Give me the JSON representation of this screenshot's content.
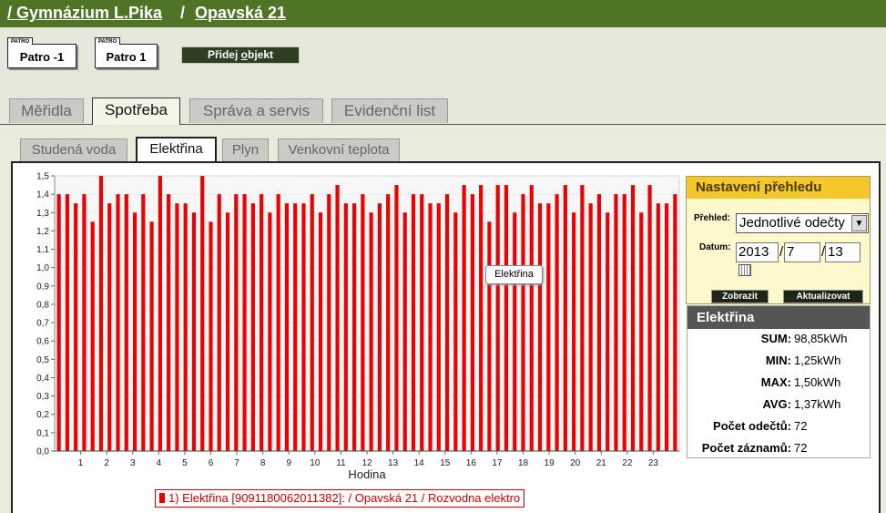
{
  "breadcrumb": {
    "school": "/ Gymnázium L.Pika",
    "sep": "/",
    "address": "Opavská 21"
  },
  "floors": [
    {
      "tag": "PATRO",
      "label": "Patro -1"
    },
    {
      "tag": "PATRO",
      "label": "Patro 1"
    }
  ],
  "add_object": {
    "pre": "Přidej ",
    "accel": "o",
    "post": "bjekt"
  },
  "tabs": [
    "Měřidla",
    "Spotřeba",
    "Správa a servis",
    "Evidenční list"
  ],
  "active_tab": "Spotřeba",
  "subtabs": [
    "Studená voda",
    "Elektřina",
    "Plyn",
    "Venkovní teplota"
  ],
  "active_subtab": "Elektřina",
  "settings": {
    "title": "Nastavení přehledu",
    "prehled_label": "Přehled:",
    "prehled_value": "Jednotlivé odečty",
    "datum_label": "Datum:",
    "year": "2013",
    "month": "7",
    "day": "13",
    "show_button": "Zobrazit",
    "update_button": "Aktualizovat"
  },
  "stats": {
    "title": "Elektřina",
    "rows": [
      {
        "key": "SUM:",
        "value": "98,85kWh"
      },
      {
        "key": "MIN:",
        "value": "1,25kWh"
      },
      {
        "key": "MAX:",
        "value": "1,50kWh"
      },
      {
        "key": "AVG:",
        "value": "1,37kWh"
      },
      {
        "key": "Počet odečtů:",
        "value": "72"
      },
      {
        "key": "Počet záznamů:",
        "value": "72"
      }
    ]
  },
  "tooltip": "Elektřina",
  "legend": "1) Elektřina [9091180062011382]:  / Opavská 21 / Rozvodna elektro",
  "chart_data": {
    "type": "bar",
    "xlabel": "Hodina",
    "ylabel": "",
    "ylim": [
      0,
      1.5
    ],
    "yticks": [
      "0,0",
      "0,1",
      "0,2",
      "0,3",
      "0,4",
      "0,5",
      "0,6",
      "0,7",
      "0,8",
      "0,9",
      "1,0",
      "1,1",
      "1,2",
      "1,3",
      "1,4",
      "1,5"
    ],
    "xticks": [
      "1",
      "2",
      "3",
      "4",
      "5",
      "6",
      "7",
      "8",
      "9",
      "10",
      "11",
      "12",
      "13",
      "14",
      "15",
      "16",
      "17",
      "18",
      "19",
      "20",
      "21",
      "22",
      "23"
    ],
    "grid": true,
    "bar_color": "#ee0000",
    "series": [
      {
        "name": "Elektřina",
        "values": [
          1.4,
          1.4,
          1.35,
          1.4,
          1.25,
          1.5,
          1.35,
          1.4,
          1.4,
          1.3,
          1.4,
          1.25,
          1.5,
          1.4,
          1.35,
          1.35,
          1.3,
          1.5,
          1.25,
          1.4,
          1.3,
          1.4,
          1.4,
          1.35,
          1.4,
          1.3,
          1.4,
          1.35,
          1.35,
          1.35,
          1.4,
          1.3,
          1.4,
          1.45,
          1.35,
          1.35,
          1.4,
          1.3,
          1.35,
          1.4,
          1.45,
          1.3,
          1.4,
          1.4,
          1.35,
          1.35,
          1.4,
          1.3,
          1.45,
          1.4,
          1.45,
          1.25,
          1.45,
          1.45,
          1.3,
          1.4,
          1.45,
          1.35,
          1.35,
          1.4,
          1.45,
          1.3,
          1.45,
          1.35,
          1.4,
          1.3,
          1.4,
          1.4,
          1.45,
          1.3,
          1.45,
          1.35,
          1.35,
          1.4
        ]
      }
    ]
  }
}
